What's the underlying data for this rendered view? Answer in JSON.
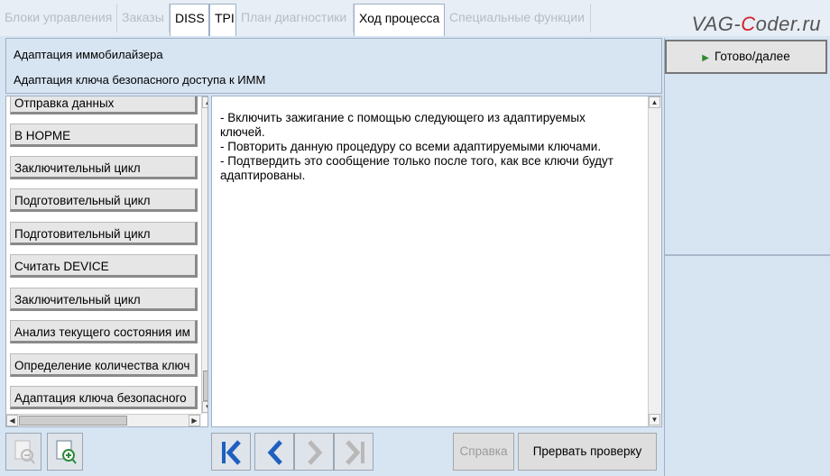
{
  "tabs": [
    {
      "label": "Блоки управления",
      "active": false
    },
    {
      "label": "Заказы",
      "active": false
    },
    {
      "label": "DISS",
      "active": true
    },
    {
      "label": "TPI",
      "active": true
    },
    {
      "label": "План диагностики",
      "active": false
    },
    {
      "label": "Ход процесса",
      "active": true
    },
    {
      "label": "Специальные функции",
      "active": false
    }
  ],
  "watermark": {
    "part1": "VAG-",
    "part2": "C",
    "part3": "oder.ru"
  },
  "header": {
    "title": "Адаптация иммобилайзера",
    "subtitle": "Адаптация ключа безопасного доступа к ИММ"
  },
  "steps": [
    "Отправка данных",
    "В НОРМЕ",
    "Заключительный цикл",
    "Подготовительный цикл",
    "Подготовительный цикл",
    "Считать DEVICE",
    "Заключительный цикл",
    "Анализ текущего состояния им",
    "Определение количества ключ",
    "Адаптация ключа безопасного"
  ],
  "instructions": [
    "- Включить зажигание с помощью следующего из адаптируемых",
    "ключей.",
    "- Повторить данную процедуру со всеми адаптируемыми ключами.",
    "- Подтвердить это сообщение только после того, как все ключи будут",
    "адаптированы."
  ],
  "actions": {
    "next_label": "Готово/далее",
    "help_label": "Справка",
    "abort_label": "Прервать проверку"
  },
  "colors": {
    "accent_blue": "#1f5fbf",
    "panel_blue": "#d7e4f2",
    "play_green": "#2f8a2f",
    "watermark_red": "#d4202a"
  }
}
